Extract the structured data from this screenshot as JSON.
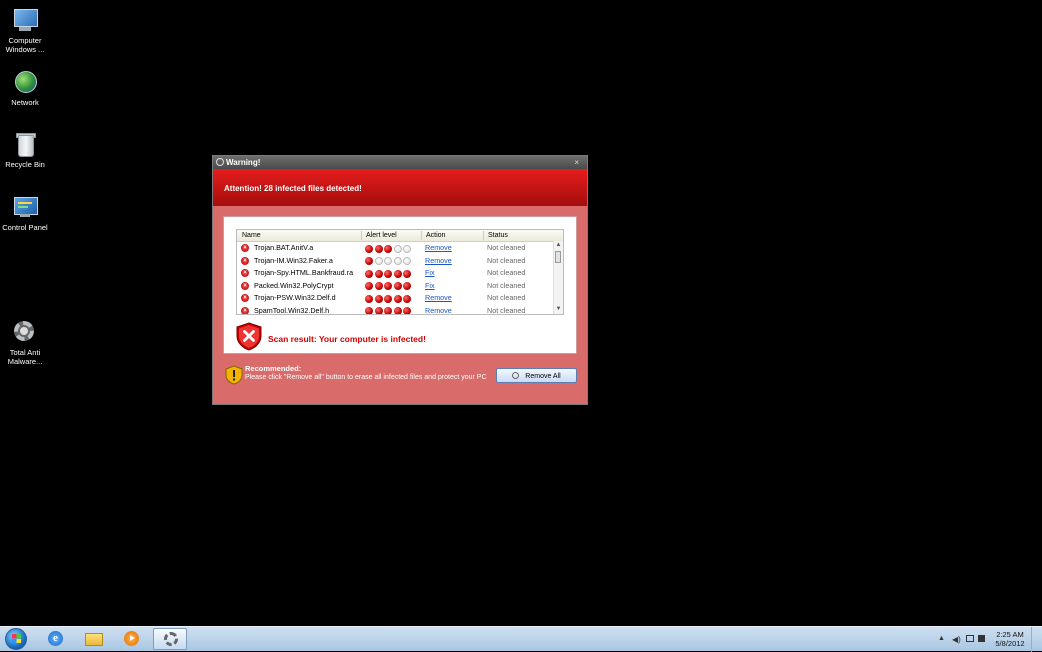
{
  "desktop": {
    "icons": [
      {
        "label": "Computer",
        "sublabel": "Windows ...",
        "icon": "computer-icon"
      },
      {
        "label": "Network",
        "icon": "network-icon"
      },
      {
        "label": "Recycle Bin",
        "icon": "recycle-bin-icon"
      },
      {
        "label": "Control Panel",
        "icon": "control-panel-icon"
      },
      {
        "label": "Total Anti",
        "sublabel": "Malware...",
        "icon": "antimalware-icon"
      }
    ]
  },
  "window": {
    "title": "Warning!",
    "close": "×",
    "alert": "Attention! 28 infected files detected!",
    "columns": [
      "Name",
      "Alert level",
      "Action",
      "Status"
    ],
    "rows": [
      {
        "name": "Trojan.BAT.AnitV.a",
        "level": 3,
        "action": "Remove",
        "status": "Not cleaned"
      },
      {
        "name": "Trojan-IM.Win32.Faker.a",
        "level": 1,
        "action": "Remove",
        "status": "Not cleaned"
      },
      {
        "name": "Trojan-Spy.HTML.Bankfraud.ra",
        "level": 5,
        "action": "Fix",
        "status": "Not cleaned"
      },
      {
        "name": "Packed.Win32.PolyCrypt",
        "level": 5,
        "action": "Fix",
        "status": "Not cleaned"
      },
      {
        "name": "Trojan-PSW.Win32.Delf.d",
        "level": 5,
        "action": "Remove",
        "status": "Not cleaned"
      },
      {
        "name": "SpamTool.Win32.Delf.h",
        "level": 5,
        "action": "Remove",
        "status": "Not cleaned"
      }
    ],
    "max_level": 5,
    "scan_result": "Scan result: Your computer is infected!",
    "recommended_title": "Recommended:",
    "recommended_text": "Please click \"Remove all\" button to erase all infected files and protect your PC",
    "remove_all_label": "Remove All"
  },
  "taskbar": {
    "pinned": [
      "start-orb-icon",
      "internet-explorer-icon",
      "folder-icon",
      "media-player-icon",
      "antimalware-icon"
    ],
    "clock_time": "2:25 AM",
    "clock_date": "5/8/2012"
  },
  "colors": {
    "alert_red": "#d10000",
    "window_bg": "#d96b6b",
    "link": "#1a55c9"
  }
}
